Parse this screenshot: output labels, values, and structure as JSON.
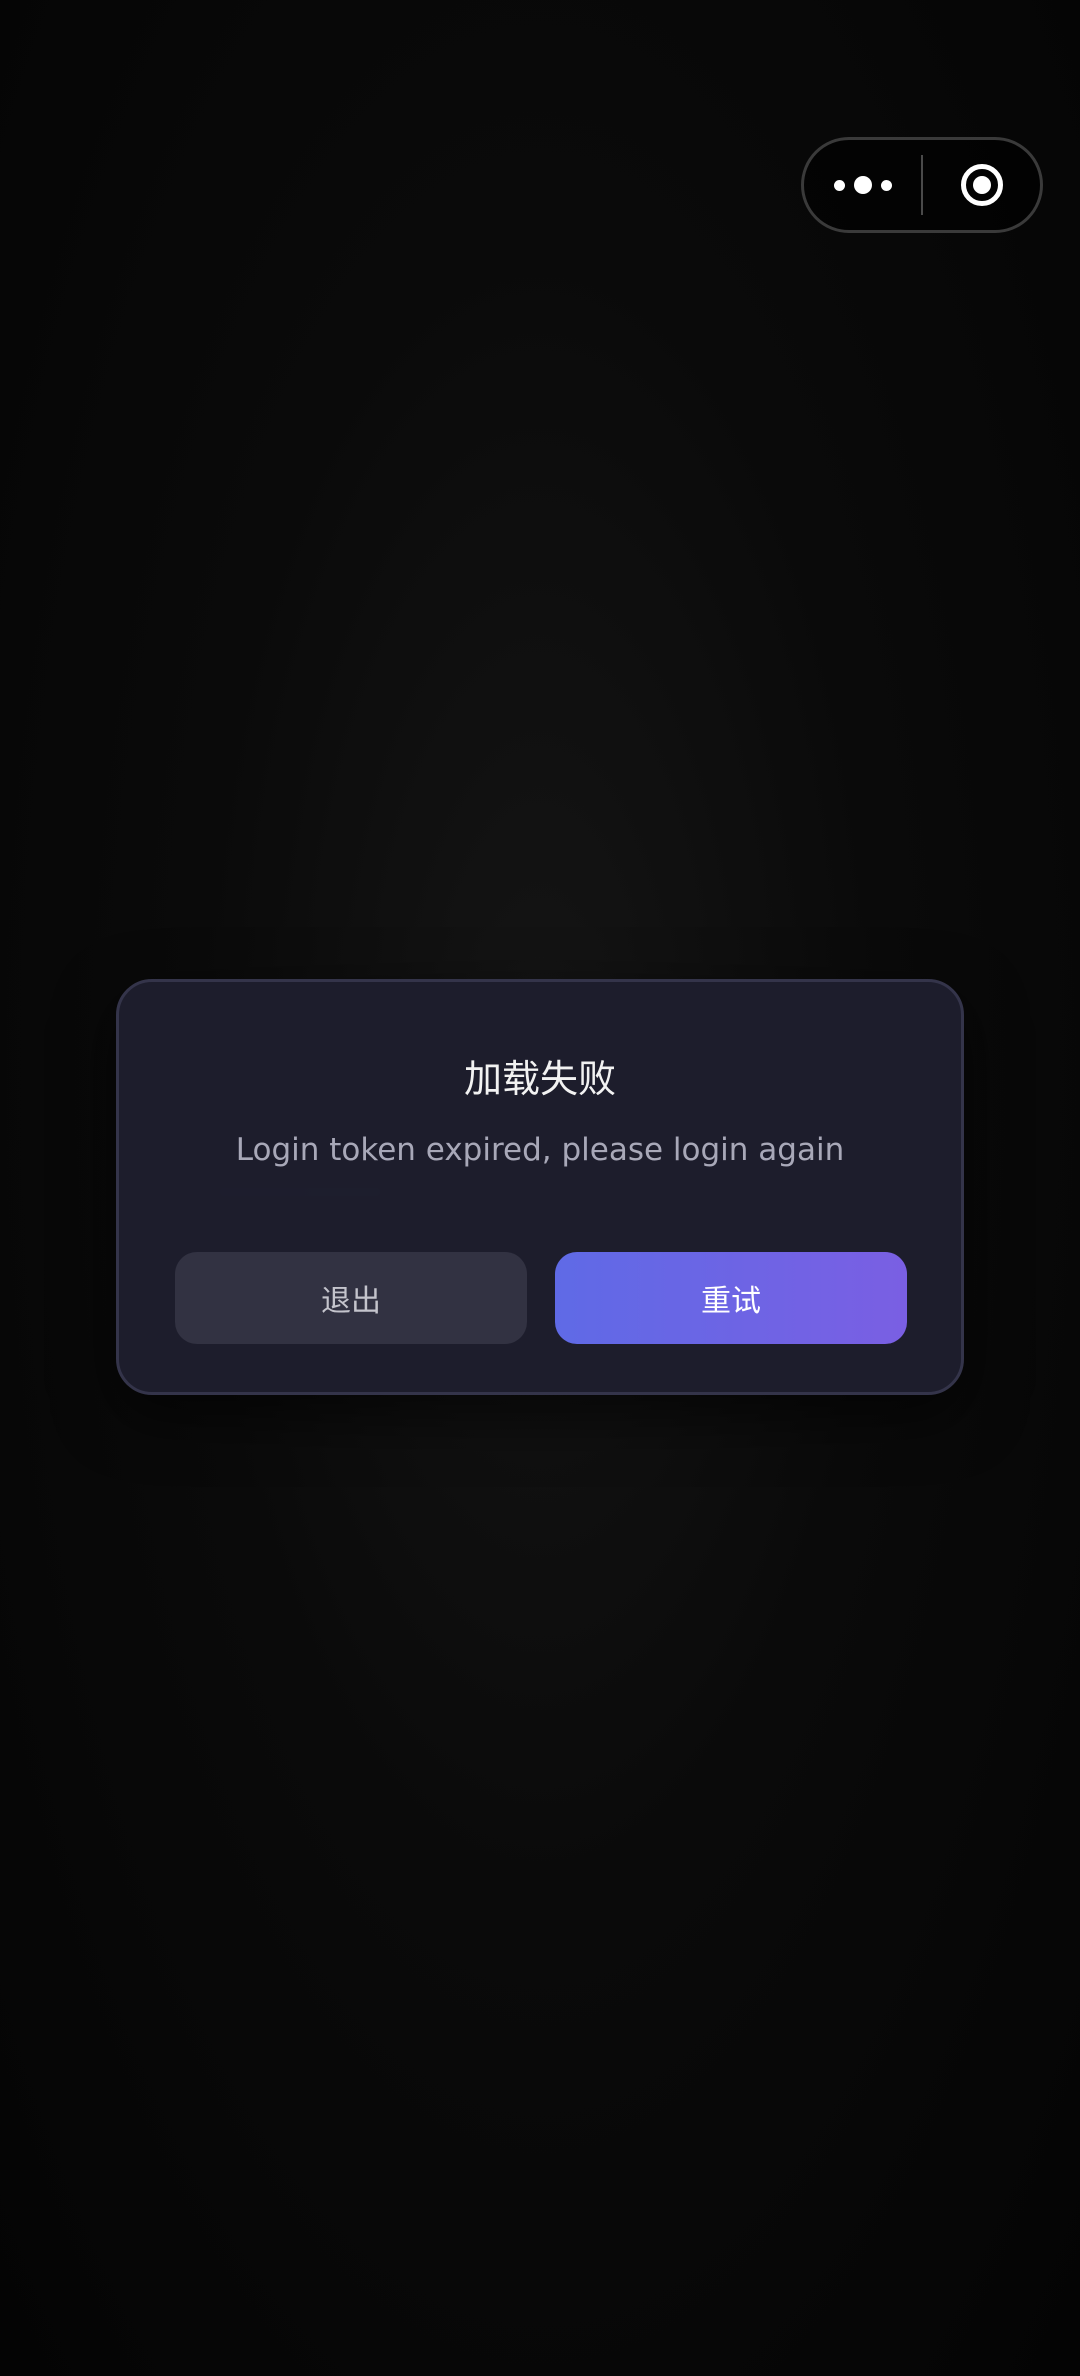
{
  "capsule": {
    "more_icon": "more-dots-icon",
    "close_icon": "target-circle-icon"
  },
  "dialog": {
    "title": "加载失败",
    "message": "Login token expired, please login again",
    "exit_label": "退出",
    "retry_label": "重试"
  },
  "colors": {
    "background": "#050505",
    "dialog_bg": "#1e1e2e",
    "retry_gradient_start": "#5f6ae6",
    "retry_gradient_end": "#7a5fe3",
    "exit_bg": "#323242"
  }
}
